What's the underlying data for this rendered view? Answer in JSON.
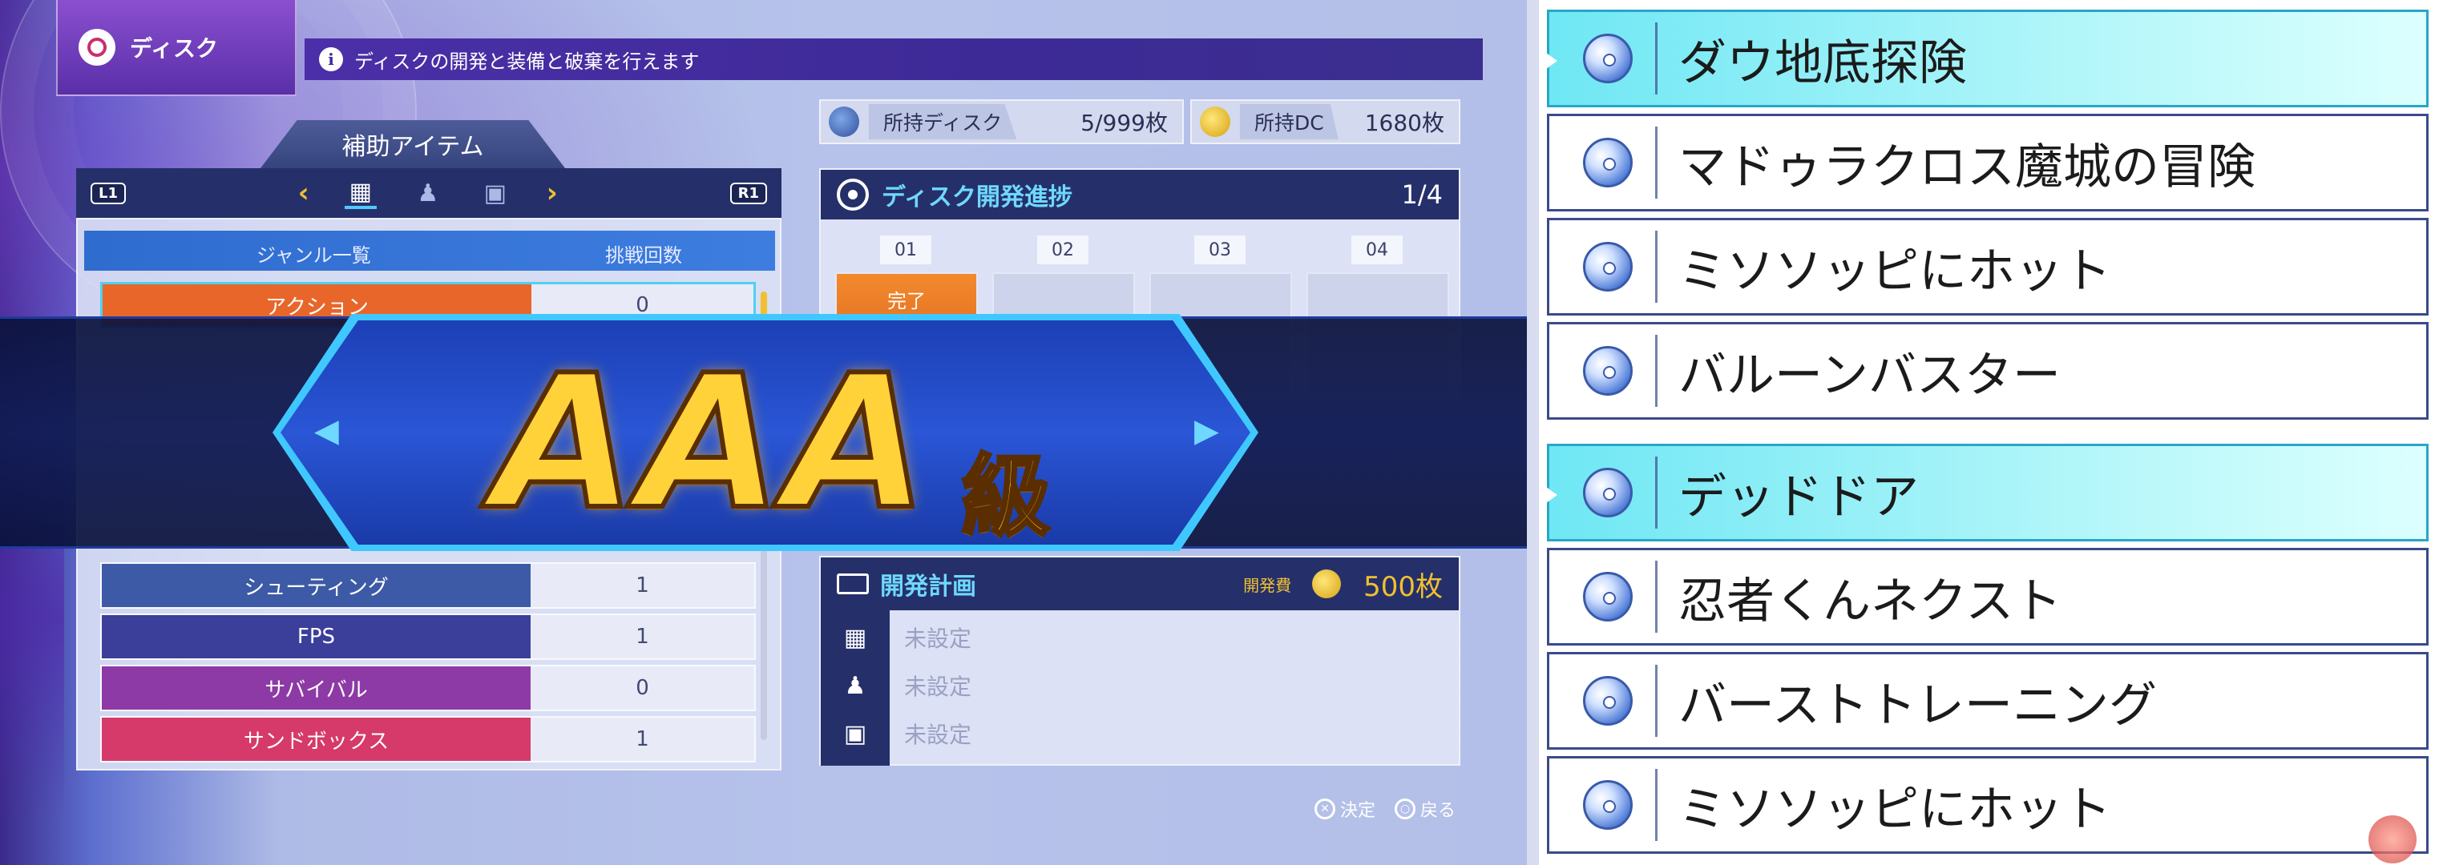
{
  "game": {
    "disc_tab_label": "ディスク",
    "info_text": "ディスクの開発と装備と破棄を行えます",
    "counters": {
      "disc_label": "所持ディスク",
      "disc_value": "5/999枚",
      "dc_label": "所持DC",
      "dc_value": "1680枚"
    },
    "list": {
      "tab_title": "補助アイテム",
      "l_button": "L1",
      "r_button": "R1",
      "col_genre": "ジャンル一覧",
      "col_count": "挑戦回数",
      "rows": [
        {
          "name": "アクション",
          "count": "0",
          "color": "#e8662a"
        },
        {
          "name": "シューティング",
          "count": "1",
          "color": "#3d5aa6"
        },
        {
          "name": "FPS",
          "count": "1",
          "color": "#3b3f9a"
        },
        {
          "name": "サバイバル",
          "count": "0",
          "color": "#8d3aa6"
        },
        {
          "name": "サンドボックス",
          "count": "1",
          "color": "#d63a6a"
        }
      ]
    },
    "progress": {
      "title": "ディスク開発進捗",
      "count": "1/4",
      "slots": [
        "01",
        "02",
        "03",
        "04"
      ],
      "done_label": "完了"
    },
    "plan": {
      "title": "開発計画",
      "cost_label": "開発費",
      "cost_value": "500枚",
      "rows": [
        "未設定",
        "未設定",
        "未設定"
      ]
    },
    "hints": {
      "decide": "決定",
      "back": "戻る"
    },
    "banner": {
      "grade": "AAA",
      "suffix": "級"
    }
  },
  "right_list": {
    "items": [
      {
        "title": "ダウ地底探険",
        "selected": true
      },
      {
        "title": "マドゥラクロス魔城の冒険",
        "selected": false
      },
      {
        "title": "ミソソッピにホット",
        "selected": false
      },
      {
        "title": "バルーンバスター",
        "selected": false
      },
      {
        "title": "デッドドア",
        "selected": true
      },
      {
        "title": "忍者くんネクスト",
        "selected": false
      },
      {
        "title": "バーストトレーニング",
        "selected": false
      },
      {
        "title": "ミソソッピにホット",
        "selected": false
      }
    ]
  }
}
